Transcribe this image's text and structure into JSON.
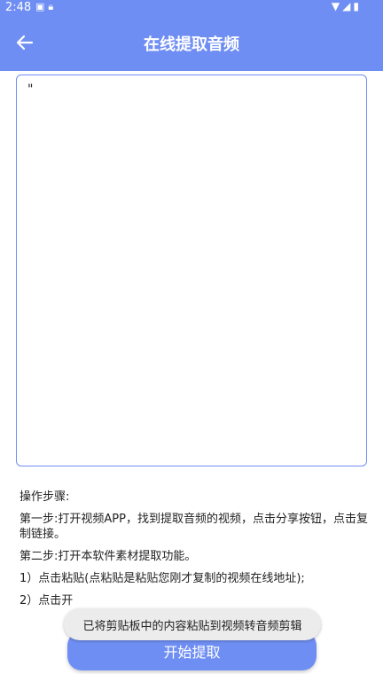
{
  "status_bar": {
    "time": "2:48",
    "left_icons": [
      "app-notification-icon",
      "lock-icon"
    ],
    "right_icons": [
      "wifi-icon",
      "signal-icon",
      "battery-icon"
    ]
  },
  "app_bar": {
    "back_icon": "arrow-left-icon",
    "title": "在线提取音频"
  },
  "input": {
    "value": "\""
  },
  "steps": {
    "heading": "操作步骤:",
    "step1": "第一步:打开视频APP，找到提取音频的视频，点击分享按钮，点击复制链接。",
    "step2": "第二步:打开本软件素材提取功能。",
    "sub1": "1）点击粘贴(点粘贴是粘贴您刚才复制的视频在线地址);",
    "sub2": "2）点击开"
  },
  "button": {
    "label": "开始提取"
  },
  "toast": {
    "message": "已将剪贴板中的内容粘贴到视频转音频剪辑"
  },
  "colors": {
    "accent": "#6f8ef3"
  }
}
